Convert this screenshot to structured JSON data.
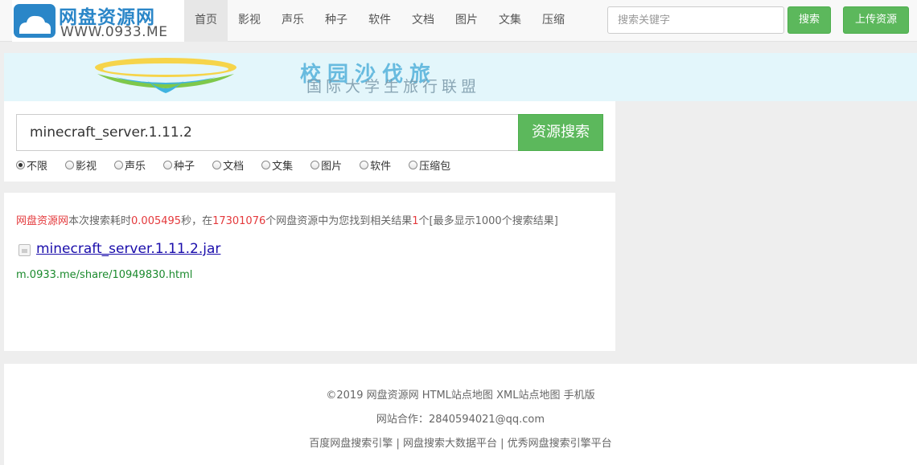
{
  "header": {
    "logo_title": "网盘资源网",
    "logo_url": "WWW.0933.ME",
    "nav": [
      "首页",
      "影视",
      "声乐",
      "种子",
      "软件",
      "文档",
      "图片",
      "文集",
      "压缩"
    ],
    "active_nav": 0,
    "search_placeholder": "搜索关键字",
    "search_button": "搜索",
    "upload_button": "上传资源"
  },
  "banner": {
    "line1": "校园沙伐旅",
    "line2": "国际大学生旅行联盟"
  },
  "search": {
    "query": "minecraft_server.1.11.2",
    "button": "资源搜索",
    "types": [
      "不限",
      "影视",
      "声乐",
      "种子",
      "文档",
      "文集",
      "图片",
      "软件",
      "压缩包"
    ],
    "selected_type": 0
  },
  "results": {
    "site_name": "网盘资源网",
    "text_before_time": "本次搜索耗时",
    "time": "0.005495",
    "text_after_time": "秒，在",
    "total_resources": "17301076",
    "text_after_total": "个网盘资源中为您找到相关结果",
    "result_count": "1",
    "text_after_count": "个[最多显示1000个搜索结果]",
    "items": [
      {
        "title": "minecraft_server.1.11.2.jar",
        "url": "m.0933.me/share/10949830.html"
      }
    ]
  },
  "footer": {
    "copyright": "©2019 网盘资源网",
    "links": [
      "HTML站点地图",
      "XML站点地图",
      "手机版"
    ],
    "contact_label": "网站合作：",
    "contact_email": "2840594021@qq.com",
    "tagline1": "百度网盘搜索引擎",
    "tagline2": "网盘搜索大数据平台",
    "tagline3": "优秀网盘搜索引擎平台",
    "separator": "|"
  },
  "colors": {
    "accent_green": "#5cb85c",
    "logo_blue": "#2a86c8",
    "highlight_red": "#e4393c",
    "link_blue": "#1a0dab",
    "url_green": "#1b8a2d"
  }
}
